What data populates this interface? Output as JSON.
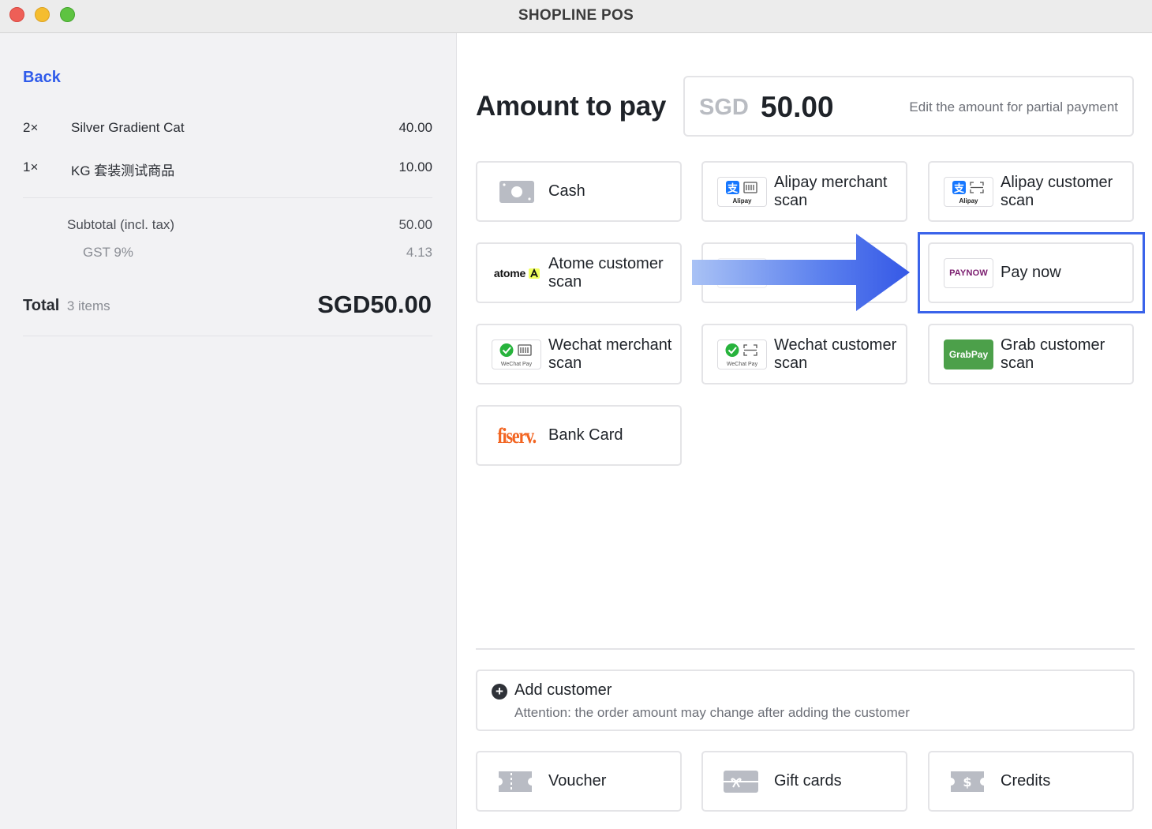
{
  "window": {
    "title": "SHOPLINE POS"
  },
  "order": {
    "back_label": "Back",
    "items": [
      {
        "qty": "2×",
        "name": "Silver Gradient Cat",
        "price": "40.00"
      },
      {
        "qty": "1×",
        "name": "KG 套装测试商品",
        "price": "10.00"
      }
    ],
    "subtotal_label": "Subtotal (incl. tax)",
    "subtotal_value": "50.00",
    "gst_label": "GST 9%",
    "gst_value": "4.13",
    "total_label": "Total",
    "total_items": "3 items",
    "total_value": "SGD50.00"
  },
  "payment": {
    "amount_title": "Amount to pay",
    "currency": "SGD",
    "amount": "50.00",
    "amount_hint": "Edit the amount for partial payment",
    "methods": [
      {
        "label": "Cash",
        "icon": "cash-icon"
      },
      {
        "label": "Alipay merchant scan",
        "icon": "alipay-merchant-logo"
      },
      {
        "label": "Alipay customer scan",
        "icon": "alipay-customer-logo"
      },
      {
        "label": "Atome customer scan",
        "icon": "atome-logo"
      },
      {
        "label": "",
        "icon": "hidden-method-logo"
      },
      {
        "label": "Pay now",
        "icon": "paynow-logo",
        "highlighted": true
      },
      {
        "label": "Wechat merchant scan",
        "icon": "wechat-merchant-logo"
      },
      {
        "label": "Wechat customer scan",
        "icon": "wechat-customer-logo"
      },
      {
        "label": "Grab customer scan",
        "icon": "grabpay-logo"
      },
      {
        "label": "Bank Card",
        "icon": "fiserv-logo"
      }
    ],
    "logo_text": {
      "alipay": "Alipay",
      "wechat": "WeChat Pay",
      "atome": "atome",
      "paynow": "PAYNOW",
      "grabpay": "GrabPay",
      "fiserv": "fiserv."
    }
  },
  "customer": {
    "title": "Add customer",
    "note": "Attention: the order amount may change after adding the customer"
  },
  "extras": [
    {
      "label": "Voucher",
      "icon": "voucher-icon"
    },
    {
      "label": "Gift cards",
      "icon": "gift-card-icon"
    },
    {
      "label": "Credits",
      "icon": "credits-icon"
    }
  ],
  "colors": {
    "accent": "#3a63ea",
    "link": "#2f5bea",
    "grab": "#4ca04a",
    "fiserv": "#f26522",
    "wechat": "#27b33c",
    "alipay": "#1677ff",
    "paynow": "#7b1d6f"
  }
}
